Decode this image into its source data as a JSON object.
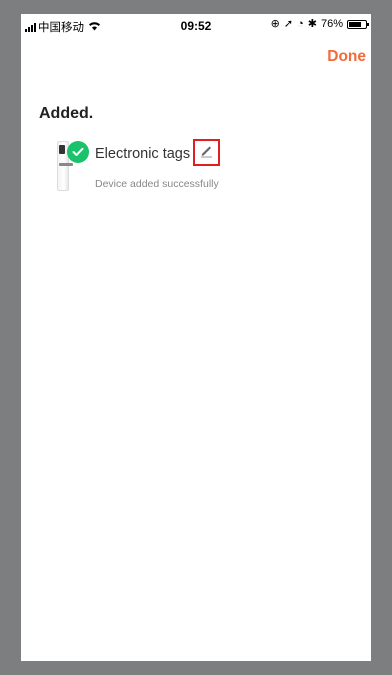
{
  "status_bar": {
    "carrier": "中国移动",
    "time": "09:52",
    "battery_percent": "76%",
    "battery_level": 0.76,
    "icons": [
      "signal-icon",
      "wifi-icon",
      "lock-rotation-icon",
      "location-icon",
      "alarm-icon",
      "bluetooth-icon",
      "battery-icon"
    ]
  },
  "header": {
    "done_label": "Done",
    "accent_color": "#f26b3a"
  },
  "main": {
    "heading": "Added.",
    "device": {
      "name": "Electronic tags",
      "status": "Device added successfully",
      "status_icon": "check-icon",
      "status_color": "#19c26b",
      "edit_icon": "pencil-icon"
    }
  }
}
